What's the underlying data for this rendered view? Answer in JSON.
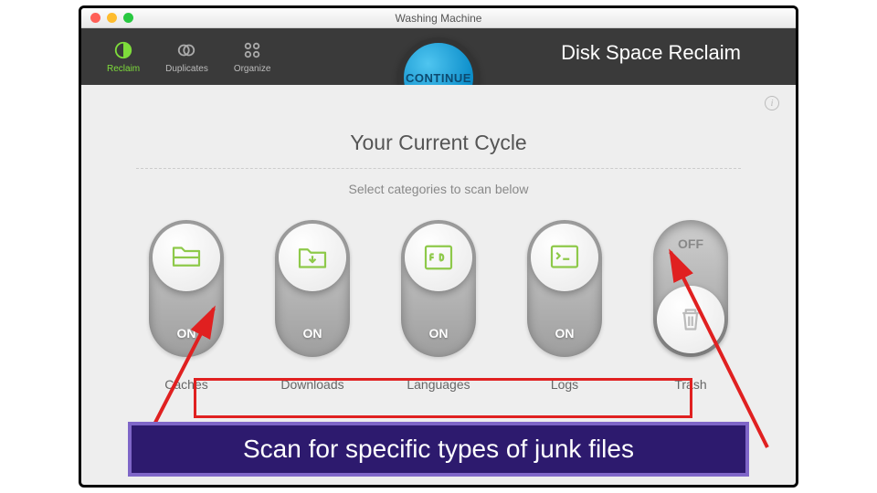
{
  "window": {
    "title": "Washing Machine"
  },
  "toolbar": {
    "items": [
      {
        "label": "Reclaim",
        "active": true
      },
      {
        "label": "Duplicates",
        "active": false
      },
      {
        "label": "Organize",
        "active": false
      }
    ],
    "continue_label": "CONTINUE",
    "section_title": "Disk Space Reclaim"
  },
  "main": {
    "cycle_heading": "Your Current Cycle",
    "subtitle": "Select categories to scan below",
    "toggles": [
      {
        "name": "Caches",
        "state": "ON",
        "on": true,
        "icon": "folder-stack-icon"
      },
      {
        "name": "Downloads",
        "state": "ON",
        "on": true,
        "icon": "download-folder-icon"
      },
      {
        "name": "Languages",
        "state": "ON",
        "on": true,
        "icon": "languages-icon"
      },
      {
        "name": "Logs",
        "state": "ON",
        "on": true,
        "icon": "terminal-icon"
      },
      {
        "name": "Trash",
        "state": "OFF",
        "on": false,
        "icon": "trash-icon"
      }
    ]
  },
  "annotation": {
    "callout": "Scan for specific types of junk files"
  },
  "colors": {
    "accent_green": "#7edc3b",
    "icon_stroke": "#8ec94a"
  }
}
